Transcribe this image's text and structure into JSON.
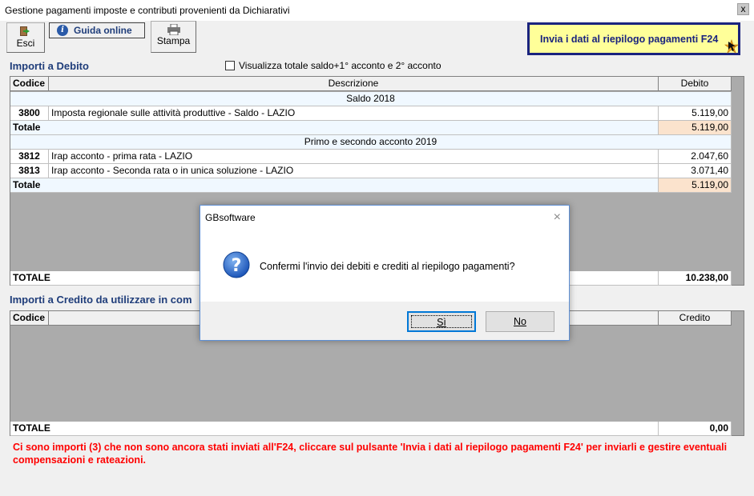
{
  "window": {
    "title": "Gestione pagamenti imposte e contributi provenienti da Dichiarativi",
    "close_label": "x"
  },
  "toolbar": {
    "esci_label": "Esci",
    "guida_label": "Guida online",
    "stampa_label": "Stampa",
    "invia_label": "Invia i dati al riepilogo pagamenti F24"
  },
  "debito": {
    "section_title": "Importi a Debito",
    "checkbox_label": "Visualizza totale saldo+1° acconto e 2° acconto",
    "checkbox_checked": false,
    "headers": {
      "code": "Codice",
      "desc": "Descrizione",
      "amount": "Debito"
    },
    "groups": [
      {
        "title": "Saldo 2018",
        "rows": [
          {
            "code": "3800",
            "desc": "Imposta regionale sulle attività produttive - Saldo - LAZIO",
            "amount": "5.119,00"
          }
        ],
        "total_label": "Totale",
        "total": "5.119,00"
      },
      {
        "title": "Primo e secondo acconto 2019",
        "rows": [
          {
            "code": "3812",
            "desc": "Irap acconto - prima rata - LAZIO",
            "amount": "2.047,60"
          },
          {
            "code": "3813",
            "desc": "Irap acconto - Seconda rata o in unica soluzione - LAZIO",
            "amount": "3.071,40"
          }
        ],
        "total_label": "Totale",
        "total": "5.119,00"
      }
    ],
    "grand_total_label": "TOTALE",
    "grand_total": "10.238,00"
  },
  "credito": {
    "section_title": "Importi a Credito da utilizzare in com",
    "headers": {
      "code": "Codice",
      "amount": "Credito"
    },
    "grand_total_label": "TOTALE",
    "grand_total": "0,00"
  },
  "message": "Ci sono importi (3) che non sono ancora stati inviati all'F24, cliccare sul pulsante 'Invia i dati al riepilogo pagamenti F24' per inviarli e gestire eventuali compensazioni e rateazioni.",
  "dialog": {
    "title": "GBsoftware",
    "close_label": "×",
    "text": "Confermi l'invio dei debiti e crediti al riepilogo pagamenti?",
    "yes_label": "Sì",
    "no_label": "No"
  }
}
